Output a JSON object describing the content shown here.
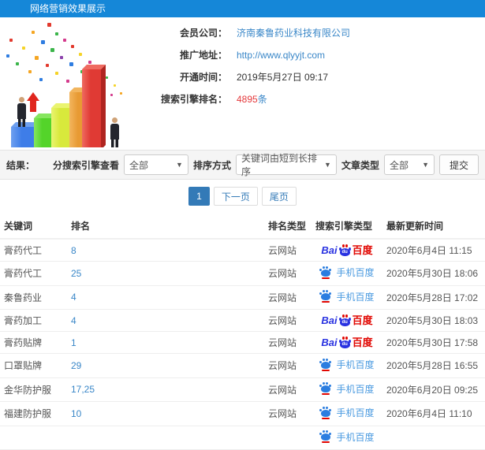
{
  "header": {
    "title": "网络营销效果展示"
  },
  "info": {
    "rows": [
      {
        "label": "会员公司：",
        "value": "济南秦鲁药业科技有限公司"
      },
      {
        "label": "推广地址：",
        "value": "http://www.qlyyjt.com"
      },
      {
        "label": "开通时间：",
        "value": "2019年5月27日 09:17"
      },
      {
        "label": "搜索引擎排名：",
        "value": "4895",
        "suffix": "条"
      }
    ]
  },
  "filters": {
    "section_label": "结果：",
    "engine_label": "分搜索引擎查看",
    "engine_value": "全部",
    "sort_label": "排序方式",
    "sort_value": "关键词由短到长排序",
    "article_label": "文章类型",
    "article_value": "全部",
    "submit_label": "提交"
  },
  "pagination": {
    "current": "1",
    "next": "下一页",
    "last": "尾页"
  },
  "table": {
    "headers": [
      "关键词",
      "排名",
      "排名类型",
      "搜索引擎类型",
      "最新更新时间"
    ],
    "engine_labels": {
      "bai": "Bai",
      "du": "du",
      "cn": "百度",
      "mobile": "手机百度"
    },
    "rows": [
      {
        "keyword": "膏药代工",
        "rank": "8",
        "rank_type": "云网站",
        "engine": "baidu-pc",
        "updated": "2020年6月4日 11:15"
      },
      {
        "keyword": "膏药代工",
        "rank": "25",
        "rank_type": "云网站",
        "engine": "baidu-mobile",
        "updated": "2020年5月30日 18:06"
      },
      {
        "keyword": "秦鲁药业",
        "rank": "4",
        "rank_type": "云网站",
        "engine": "baidu-mobile",
        "updated": "2020年5月28日 17:02"
      },
      {
        "keyword": "膏药加工",
        "rank": "4",
        "rank_type": "云网站",
        "engine": "baidu-pc",
        "updated": "2020年5月30日 18:03"
      },
      {
        "keyword": "膏药贴牌",
        "rank": "1",
        "rank_type": "云网站",
        "engine": "baidu-pc",
        "updated": "2020年5月30日 17:58"
      },
      {
        "keyword": "口罩贴牌",
        "rank": "29",
        "rank_type": "云网站",
        "engine": "baidu-mobile",
        "updated": "2020年5月28日 16:55"
      },
      {
        "keyword": "金华防护服",
        "rank": "17,25",
        "rank_type": "云网站",
        "engine": "baidu-mobile",
        "updated": "2020年6月20日 09:25"
      },
      {
        "keyword": "福建防护服",
        "rank": "10",
        "rank_type": "云网站",
        "engine": "baidu-mobile",
        "updated": "2020年6月4日 11:10"
      }
    ],
    "partial_next_row": {
      "engine": "baidu-mobile"
    }
  },
  "colors": {
    "header_bg": "#1587d8",
    "link": "#3a87c8",
    "highlight_red": "#e4393c",
    "pager_active": "#337ab7",
    "baidu_blue": "#2932e1",
    "baidu_red": "#e10601"
  }
}
